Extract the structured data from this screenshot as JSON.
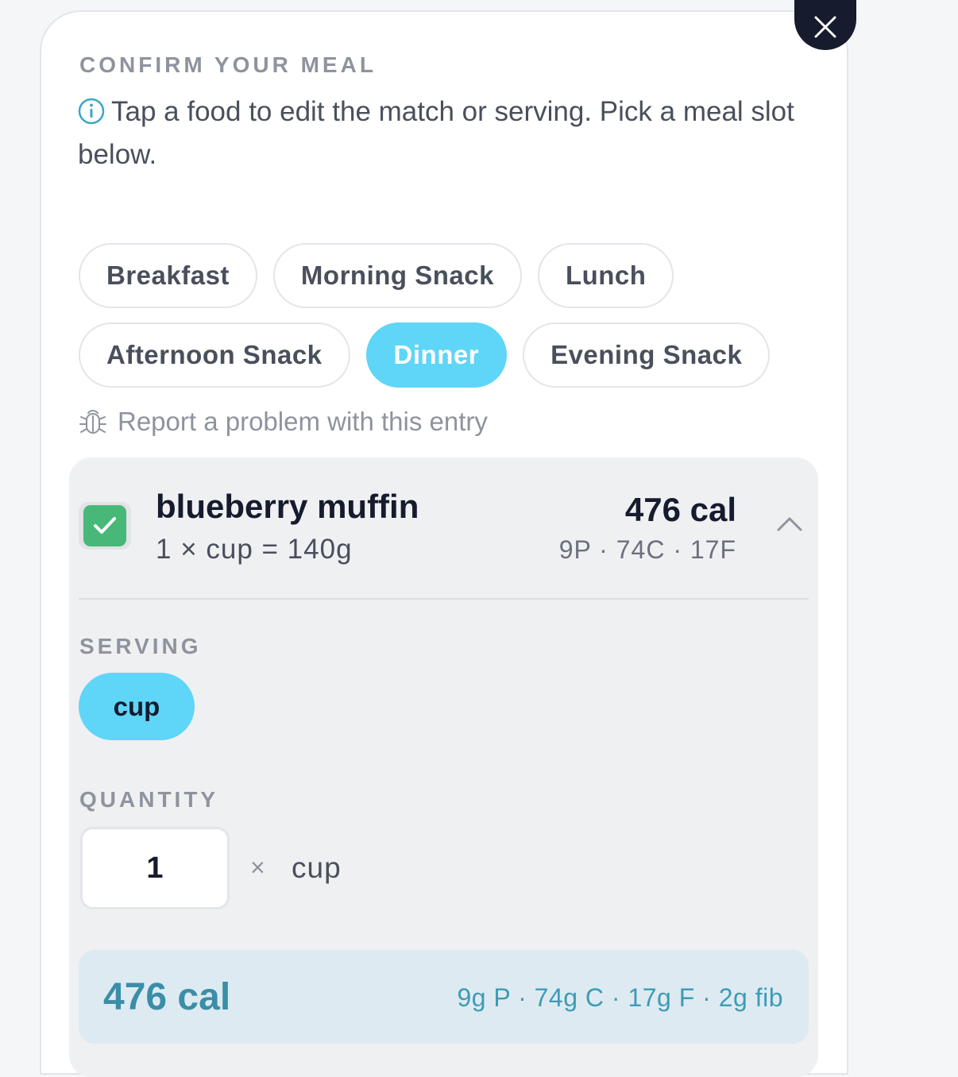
{
  "header": {
    "eyebrow": "CONFIRM YOUR MEAL",
    "helper_text": "Tap a food to edit the match or serving. Pick a meal slot below."
  },
  "meal_slots": {
    "selected": "Dinner",
    "items": [
      {
        "label": "Breakfast"
      },
      {
        "label": "Morning Snack"
      },
      {
        "label": "Lunch"
      },
      {
        "label": "Afternoon Snack"
      },
      {
        "label": "Dinner"
      },
      {
        "label": "Evening Snack"
      }
    ]
  },
  "report_link": "Report a problem with this entry",
  "food_item": {
    "name": "blueberry muffin",
    "serving_desc": "1 × cup = 140g",
    "calories": "476 cal",
    "macros": "9P · 74C · 17F",
    "checked": true,
    "serving_label": "SERVING",
    "serving_unit": "cup",
    "quantity_label": "QUANTITY",
    "quantity": "1",
    "times": "×",
    "quantity_unit": "cup",
    "summary_calories": "476 cal",
    "summary_macros": "9g P · 74g C · 17g F · 2g fib"
  },
  "colors": {
    "accent": "#5fd5f7",
    "check_green": "#48b878",
    "close_bg": "#161b2e",
    "summary_bg": "#deeaf1",
    "summary_text": "#3a8ea7"
  },
  "icons": [
    "close-icon",
    "info-icon",
    "bug-icon",
    "check-icon",
    "chevron-up-icon"
  ]
}
